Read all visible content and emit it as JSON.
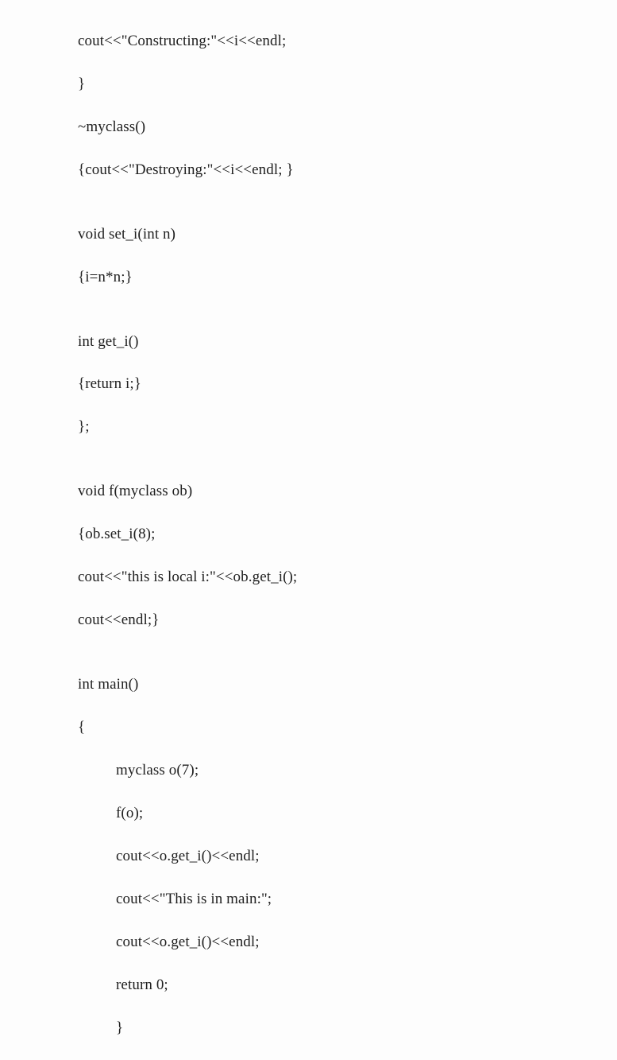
{
  "code": {
    "l01": "cout<<\"Constructing:\"<<i<<endl;",
    "l02": "}",
    "l03": "~myclass()",
    "l04": "{cout<<\"Destroying:\"<<i<<endl; }",
    "l05": "",
    "l06": "void set_i(int n)",
    "l07": "{i=n*n;}",
    "l08": "",
    "l09": "int get_i()",
    "l10": "{return i;}",
    "l11": "};",
    "l12": "",
    "l13": "void f(myclass ob)",
    "l14": "{ob.set_i(8);",
    "l15": "cout<<\"this is local i:\"<<ob.get_i();",
    "l16": "cout<<endl;}",
    "l17": "",
    "l18": "int main()",
    "l19": "{",
    "l20": "myclass o(7);",
    "l21": "f(o);",
    "l22": "cout<<o.get_i()<<endl;",
    "l23": "cout<<\"This is in main:\";",
    "l24": "cout<<o.get_i()<<endl;",
    "l25": "return 0;",
    "l26": "}"
  }
}
